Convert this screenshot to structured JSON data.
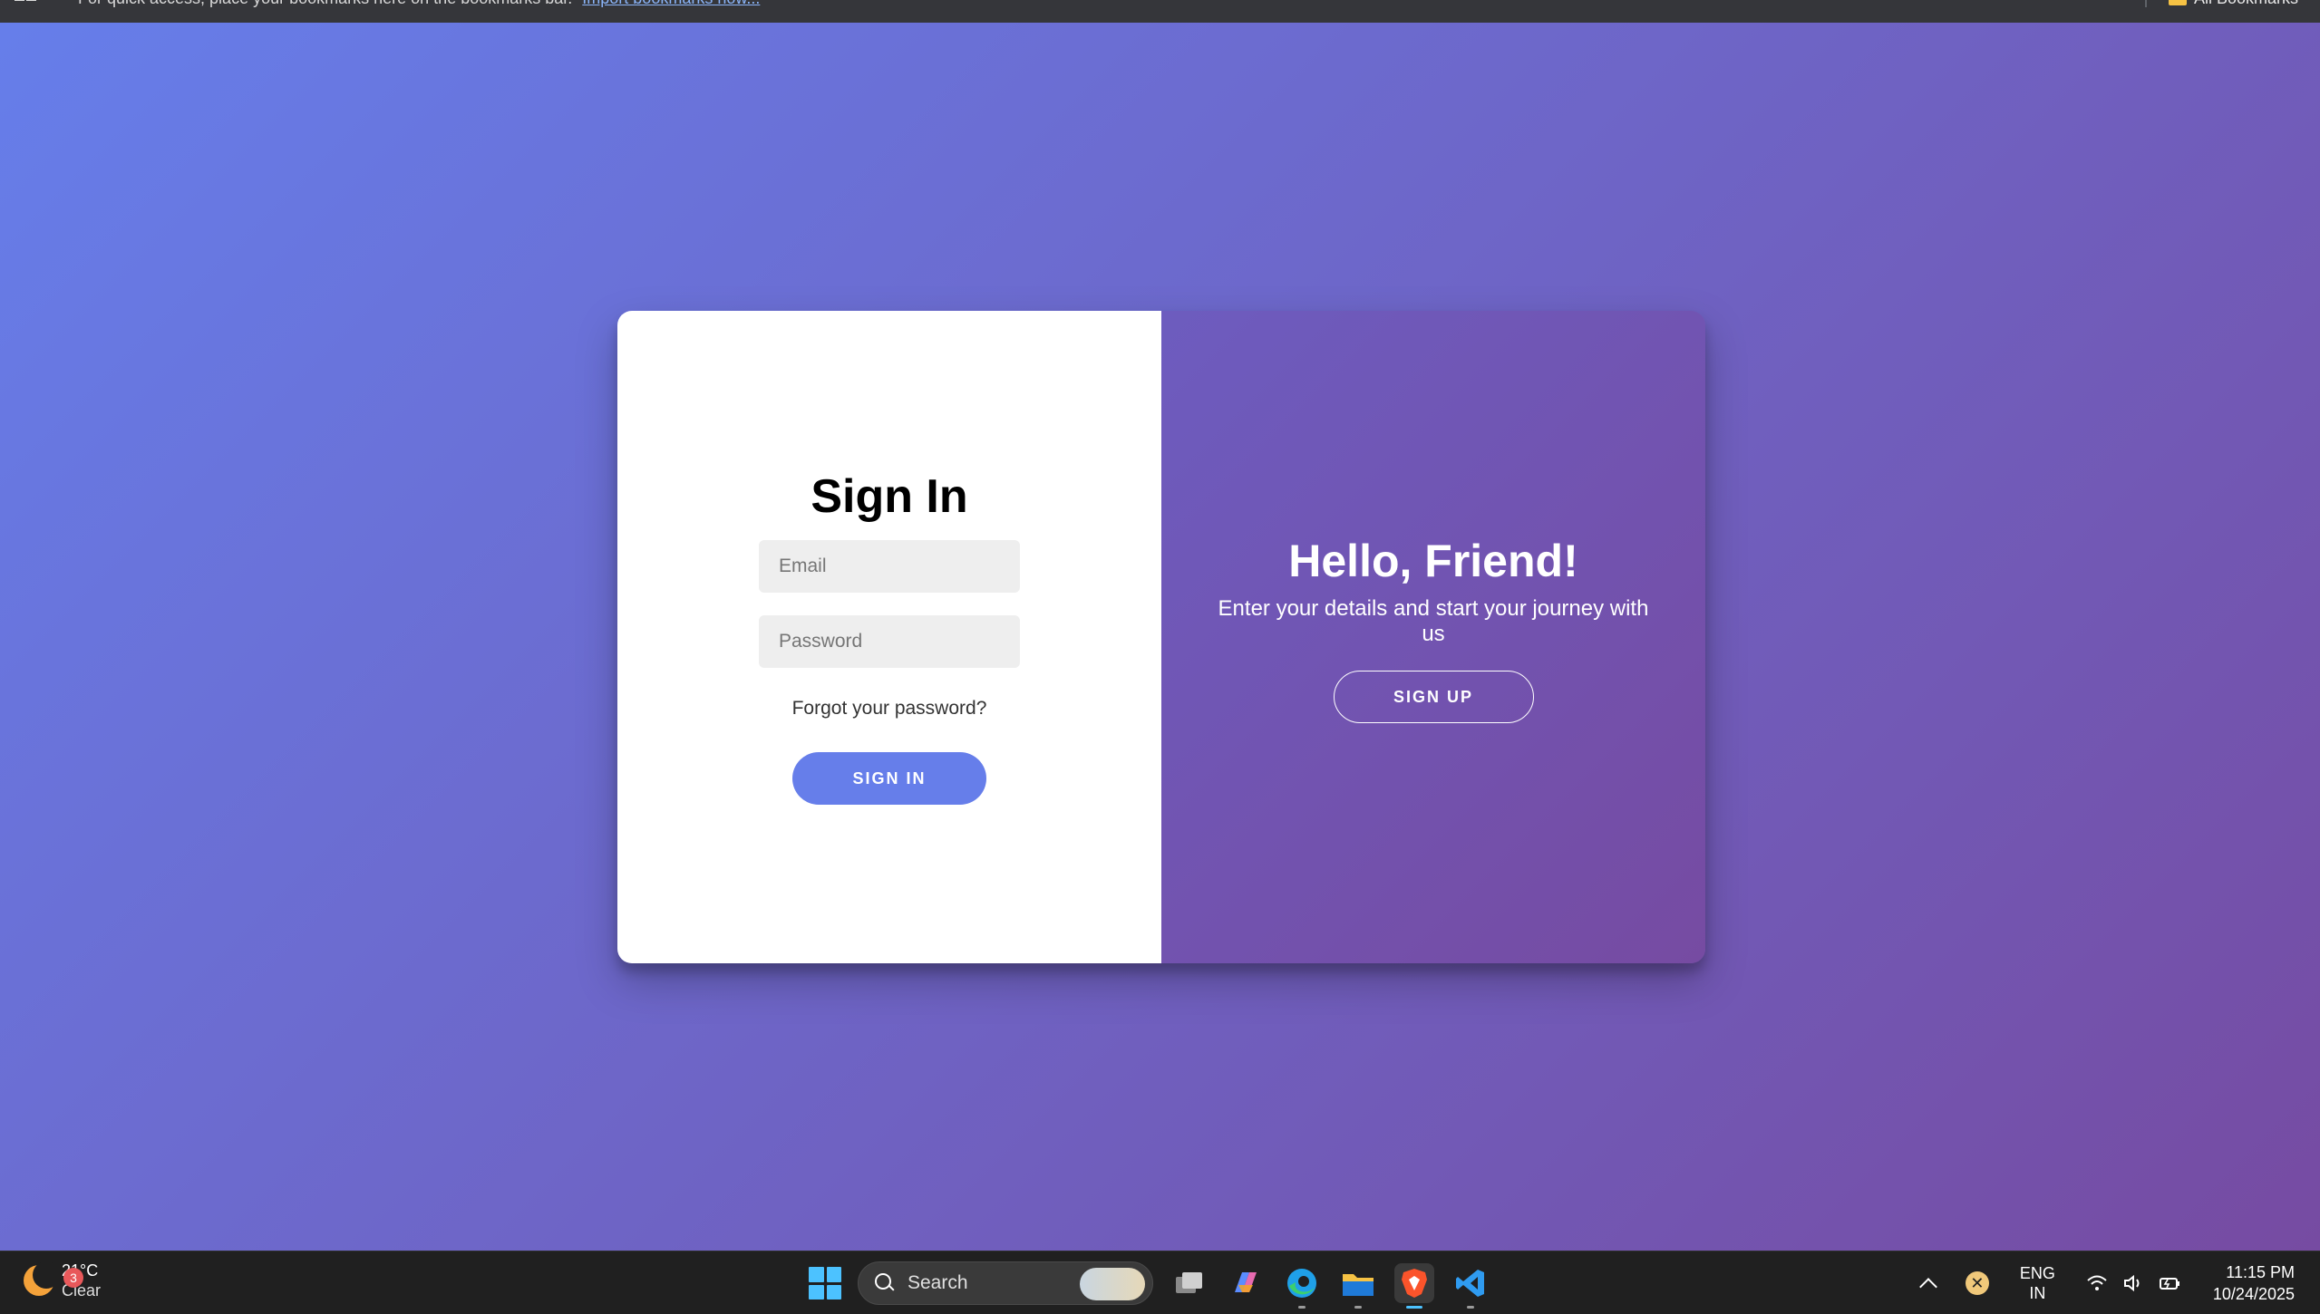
{
  "browser": {
    "bookmarks_prompt": "For quick access, place your bookmarks here on the bookmarks bar.",
    "bookmarks_import_link": "Import bookmarks now...",
    "all_bookmarks": "All Bookmarks"
  },
  "signin": {
    "title": "Sign In",
    "email_placeholder": "Email",
    "password_placeholder": "Password",
    "forgot_link": "Forgot your password?",
    "submit_label": "SIGN IN"
  },
  "overlay": {
    "title": "Hello, Friend!",
    "message": "Enter your details and start your journey with us",
    "signup_label": "SIGN UP"
  },
  "colors": {
    "gradient_start": "#667eea",
    "gradient_end": "#764ba2",
    "primary_button": "#667eea"
  },
  "taskbar": {
    "weather_badge": "3",
    "weather_temp": "21°C",
    "weather_condition": "Clear",
    "search_placeholder": "Search",
    "apps": [
      "task-view-icon",
      "copilot-icon",
      "edge-icon",
      "file-explorer-icon",
      "brave-icon",
      "vscode-icon"
    ],
    "tray_x": "✕",
    "language": "ENG",
    "region": "IN",
    "time": "11:15 PM",
    "date": "10/24/2025"
  }
}
